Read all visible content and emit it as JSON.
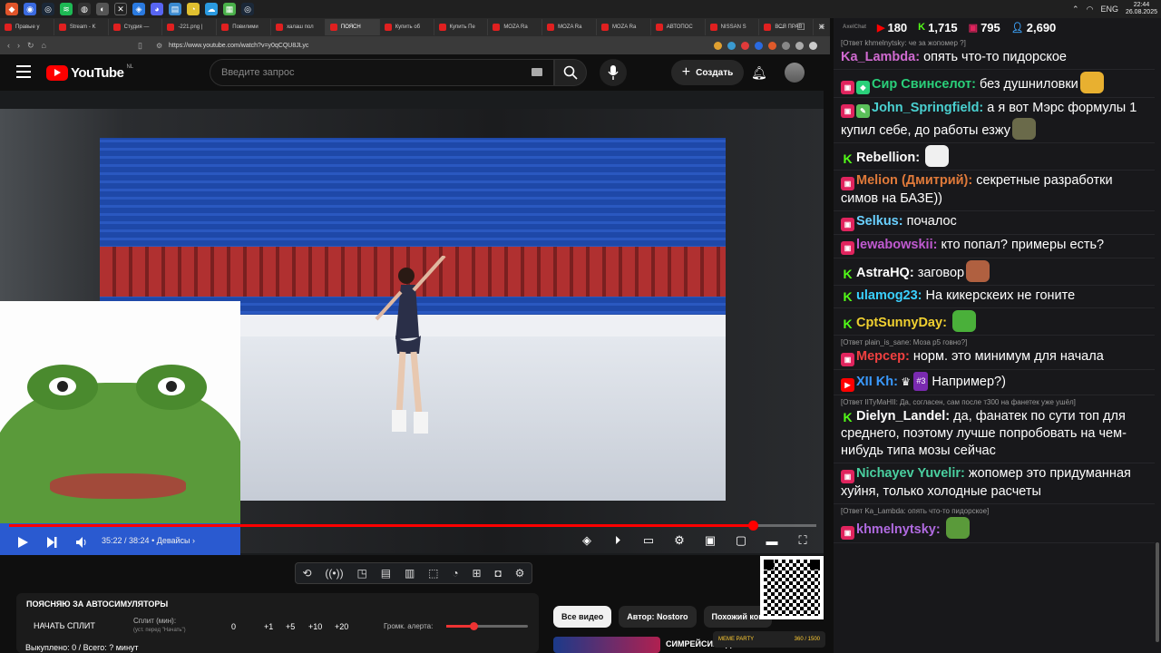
{
  "taskbar": {
    "icons": [
      "brave",
      "media",
      "steam",
      "spotify",
      "obs",
      "browser",
      "x",
      "app",
      "discord",
      "ticket",
      "chrome",
      "cloud",
      "app2",
      "steam2"
    ],
    "tray": {
      "lang": "ENG",
      "time": "22:44",
      "date": "26.08.2025"
    }
  },
  "browser": {
    "tabs": [
      "Правые у",
      "Stream - K",
      "Студия —",
      "-221.png |",
      "Повилими",
      "халаш пол",
      "ПОЯСН",
      "Купить об",
      "Купить Пе",
      "MOZA Ra",
      "MOZA Ra",
      "MOZA Ra",
      "АВТОПОС",
      "NISSAN S",
      "ВСЯ ПРАВ"
    ],
    "active_tab": 6,
    "url": "https://www.youtube.com/watch?v=y0qCQU8JLyc"
  },
  "youtube": {
    "logo": "YouTube",
    "region": "NL",
    "search_placeholder": "Введите запрос",
    "create_label": "Создать"
  },
  "player": {
    "time": "35:22 / 38:24",
    "chapter": "Девайсы",
    "progress": 0.921
  },
  "alert_panel": {
    "title": "ПОЯСНЯЮ ЗА АВТОСИМУЛЯТОРЫ",
    "start_split": "НАЧАТЬ СПЛИТ",
    "split_label": "Сплит (мин):",
    "split_hint": "(уст. перед \"Начать\")",
    "split_value": "0",
    "buttons": [
      "+1",
      "+5",
      "+10",
      "+20"
    ],
    "volume_label": "Громк. алерта:",
    "volume_level": 0.33,
    "bought": "Выкуплено: 0 / Всего: ? минут"
  },
  "chips": [
    "Все видео",
    "Автор: Nostoro",
    "Похожий кон"
  ],
  "related_title": "СИМРЕЙСИНГ ДЛЯ НОВИЧК",
  "meme_party": {
    "label": "MEME PARTY",
    "count": "360 / 1500"
  },
  "chat": {
    "app_label": "AxelChat",
    "stats": [
      {
        "icon": "yt-icon",
        "value": "180",
        "color": "#ff0000"
      },
      {
        "icon": "kick-icon",
        "value": "1,715",
        "color": "#53fc18"
      },
      {
        "icon": "vk-live-icon",
        "value": "795",
        "color": "#e0245e"
      },
      {
        "icon": "person-icon",
        "value": "2,690",
        "color": "#3ea6ff"
      }
    ],
    "messages": [
      {
        "badge": "none",
        "user": "Ka_Lambda:",
        "color": "#d06ad0",
        "reply": "[Ответ khmelnytsky: че за жопомер ?]",
        "text": "опять что-то пидорское"
      },
      {
        "badge": "live",
        "badge2": "shield",
        "user": "Сир Свинселот:",
        "color": "#2ad07a",
        "text": "без душниловки",
        "emote": "#e8b030"
      },
      {
        "badge": "live",
        "badge2": "pen",
        "user": "John_Springfield:",
        "color": "#4ad0d0",
        "text": "а я вот Мэрс формулы 1 купил себе, до работы езжу",
        "emote": "#6a6a4a"
      },
      {
        "badge": "kick",
        "user": "Rebellion:",
        "color": "#ffffff",
        "text": "",
        "emote": "#f0f0f0"
      },
      {
        "badge": "live",
        "user": "Melion (Дмитрий):",
        "color": "#e07a3a",
        "text": "секретные разработки симов на БАЗЕ))"
      },
      {
        "badge": "live",
        "user": "Selkus:",
        "color": "#6ad0ff",
        "text": "почалос"
      },
      {
        "badge": "live",
        "user": "lewabowskii:",
        "color": "#c05ad0",
        "text": "кто попал? примеры есть?"
      },
      {
        "badge": "kick",
        "user": "AstraHQ:",
        "color": "#ffffff",
        "text": "заговор",
        "emote": "#b06040"
      },
      {
        "badge": "kick",
        "user": "ulamog23:",
        "color": "#3ad0ff",
        "text": "На кикерскеих не гоните"
      },
      {
        "badge": "kick",
        "user": "CptSunnyDay:",
        "color": "#f0d030",
        "text": "",
        "emote": "#4ab03a"
      },
      {
        "badge": "live",
        "user": "Мерсер:",
        "color": "#f04040",
        "reply": "[Ответ plain_is_sane: Моза р5 говно?]",
        "text": "норм. это минимум для начала"
      },
      {
        "badge": "yt",
        "user": "XII Kh:",
        "color": "#3a9aff",
        "crown": true,
        "sub": "#3",
        "text": "Например?)"
      },
      {
        "badge": "kick",
        "user": "Dielyn_Landel:",
        "color": "#ffffff",
        "reply": "[Ответ IITyMaHII: Да, согласен, сам после т300 на фанетек уже ушёл]",
        "text": "да, фанатек по сути топ для среднего, поэтому лучше попробовать на чем-нибудь типа мозы сейчас"
      },
      {
        "badge": "live",
        "user": "Nichayev Yuvelir:",
        "color": "#4ad0a0",
        "text": "жопомер это придуманная хуйня, только холодные расчеты"
      },
      {
        "badge": "live",
        "user": "khmelnytsky:",
        "color": "#b06ae0",
        "reply": "[Ответ Ka_Lambda: опять что-то пидорское]",
        "text": "",
        "emote": "#5a9a3a"
      }
    ]
  }
}
